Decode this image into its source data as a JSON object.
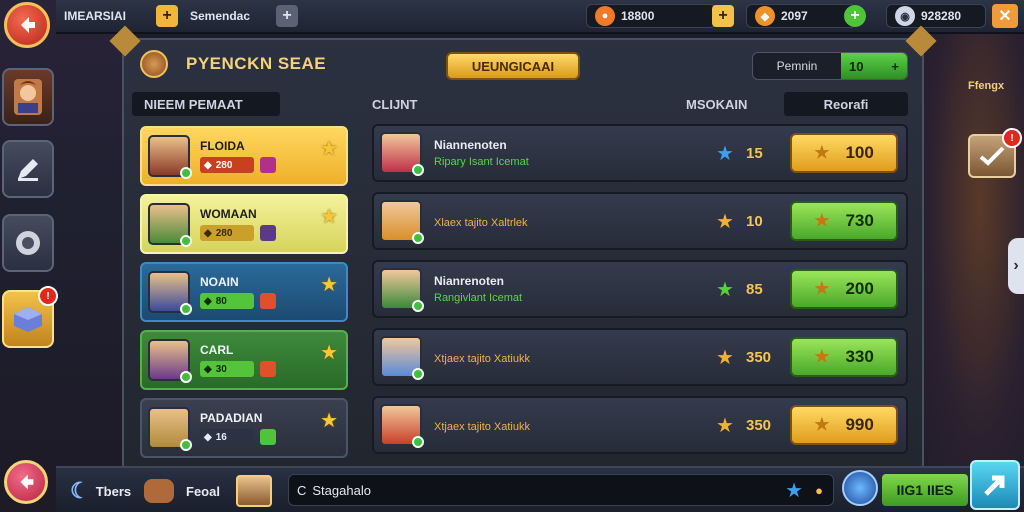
{
  "topbar": {
    "title": "IMEARSIAI",
    "subtitle": "Semendac",
    "gold_value": "18800",
    "gems_value": "2097",
    "crystals_value": "928280"
  },
  "panel": {
    "title": "PYENCKN SEAE",
    "upgrade_label": "UEUNGICAAI",
    "premium_label": "Pemnin",
    "premium_value": "10",
    "left_header": "NIEEM PEMAAT",
    "col_client": "CLIJNT",
    "col_amount": "MSOKAIN",
    "col_reward": "Reorafi"
  },
  "team": [
    {
      "name": "FLOIDA",
      "stat": "280",
      "color": "gold"
    },
    {
      "name": "WOMAAN",
      "stat": "280",
      "color": "lime"
    },
    {
      "name": "NOAIN",
      "stat": "80",
      "color": "blue"
    },
    {
      "name": "CARL",
      "stat": "30",
      "color": "green"
    },
    {
      "name": "PADADIAN",
      "stat": "16",
      "color": "dark"
    }
  ],
  "rows": [
    {
      "name": "Niannenoten",
      "sub": "Ripary Isant Icemat",
      "count": "15",
      "price": "100",
      "btn": "gold",
      "star": "#3aa0f0"
    },
    {
      "name": "",
      "sub": "Xlaex tajito Xaltrlek",
      "count": "10",
      "price": "730",
      "btn": "green",
      "star": "#f2b22e"
    },
    {
      "name": "Nianrenoten",
      "sub": "Rangivlant Icemat",
      "count": "85",
      "price": "200",
      "btn": "green",
      "star": "#57d13a"
    },
    {
      "name": "",
      "sub": "Xtjaex tajito Xatiukk",
      "count": "350",
      "price": "330",
      "btn": "green",
      "star": "#f2b22e"
    },
    {
      "name": "",
      "sub": "Xtjaex tajito Xatiukk",
      "count": "350",
      "price": "990",
      "btn": "gold",
      "star": "#f2b22e"
    }
  ],
  "right": {
    "label": "Ffengx"
  },
  "bottom": {
    "teams": "Tbers",
    "food": "Feoal",
    "chat_prefix": "C",
    "chat_value": "Stagahalo",
    "level_value": "IIG1 IIES"
  }
}
